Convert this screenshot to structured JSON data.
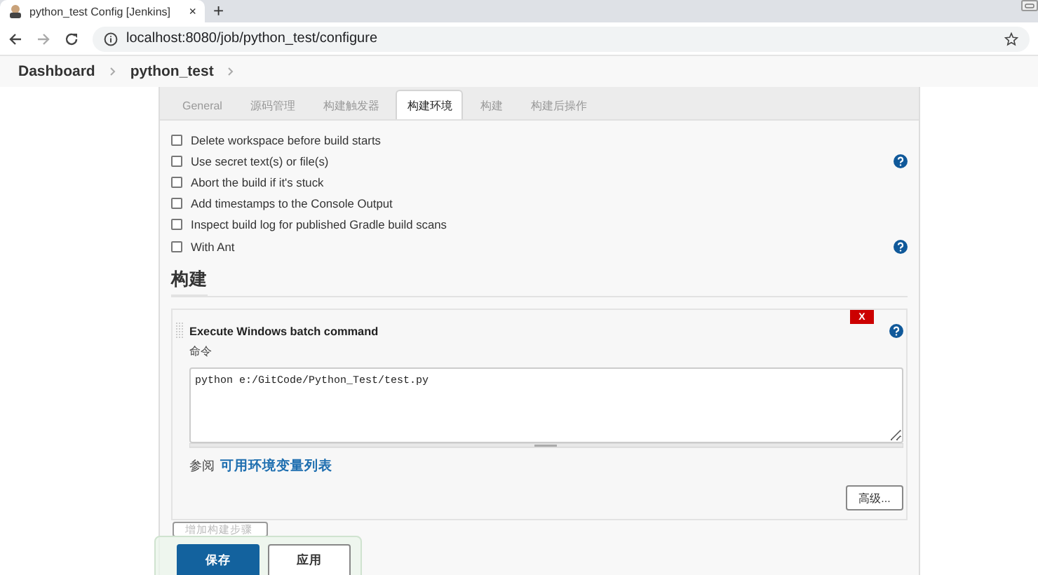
{
  "browser": {
    "tab_title": "python_test Config [Jenkins]",
    "tab_close": "×",
    "new_tab": "+",
    "url": "localhost:8080/job/python_test/configure"
  },
  "breadcrumbs": [
    {
      "label": "Dashboard"
    },
    {
      "label": "python_test"
    }
  ],
  "tabs": [
    {
      "label": "General",
      "selected": false
    },
    {
      "label": "源码管理",
      "selected": false
    },
    {
      "label": "构建触发器",
      "selected": false
    },
    {
      "label": "构建环境",
      "selected": true
    },
    {
      "label": "构建",
      "selected": false
    },
    {
      "label": "构建后操作",
      "selected": false
    }
  ],
  "build_environment": [
    {
      "label": "Delete workspace before build starts",
      "checked": false,
      "help": false
    },
    {
      "label": "Use secret text(s) or file(s)",
      "checked": false,
      "help": true
    },
    {
      "label": "Abort the build if it's stuck",
      "checked": false,
      "help": false
    },
    {
      "label": "Add timestamps to the Console Output",
      "checked": false,
      "help": false
    },
    {
      "label": "Inspect build log for published Gradle build scans",
      "checked": false,
      "help": false
    },
    {
      "label": "With Ant",
      "checked": false,
      "help": true
    }
  ],
  "build": {
    "heading": "构建",
    "step": {
      "title": "Execute Windows batch command",
      "delete": "X",
      "field_label": "命令",
      "command": "python e:/GitCode/Python_Test/test.py",
      "see_also": "参阅",
      "link": "可用环境变量列表",
      "advanced": "高级..."
    },
    "add_step": "增加构建步骤"
  },
  "footer": {
    "buttons": [
      {
        "label": "保存",
        "kind": "primary"
      },
      {
        "label": "应用",
        "kind": "secondary"
      }
    ]
  }
}
